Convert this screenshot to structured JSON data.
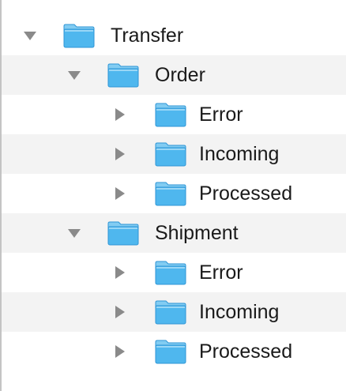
{
  "colors": {
    "folder_body": "#4fb7ee",
    "folder_tab": "#82ccf2",
    "folder_edge": "#2f96d6",
    "disclosure": "#8a8a8a",
    "stripe": "#f3f3f3"
  },
  "tree": {
    "items": [
      {
        "label": "Transfer",
        "depth": 0,
        "expanded": true,
        "icon": "folder-icon"
      },
      {
        "label": "Order",
        "depth": 1,
        "expanded": true,
        "icon": "folder-icon"
      },
      {
        "label": "Error",
        "depth": 2,
        "expanded": false,
        "icon": "folder-icon"
      },
      {
        "label": "Incoming",
        "depth": 2,
        "expanded": false,
        "icon": "folder-icon"
      },
      {
        "label": "Processed",
        "depth": 2,
        "expanded": false,
        "icon": "folder-icon"
      },
      {
        "label": "Shipment",
        "depth": 1,
        "expanded": true,
        "icon": "folder-icon"
      },
      {
        "label": "Error",
        "depth": 2,
        "expanded": false,
        "icon": "folder-icon"
      },
      {
        "label": "Incoming",
        "depth": 2,
        "expanded": false,
        "icon": "folder-icon"
      },
      {
        "label": "Processed",
        "depth": 2,
        "expanded": false,
        "icon": "folder-icon"
      }
    ]
  }
}
